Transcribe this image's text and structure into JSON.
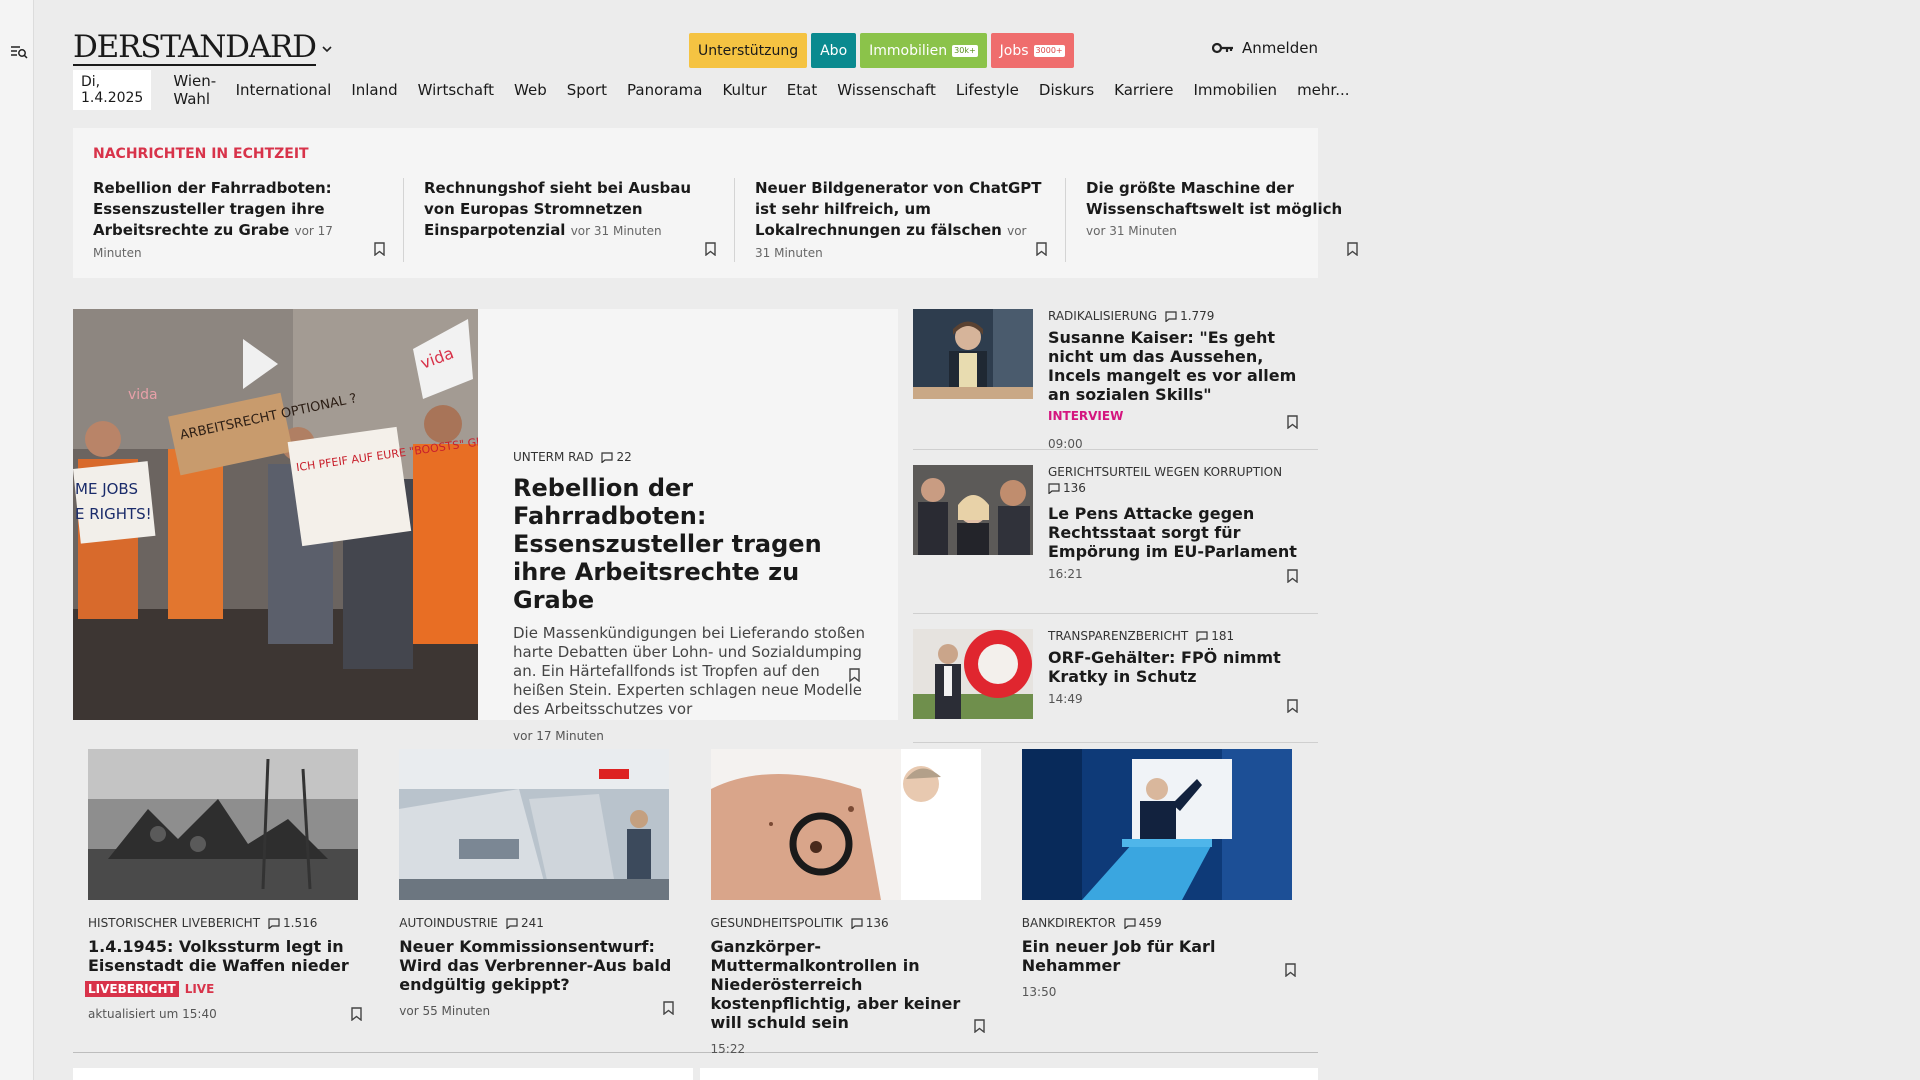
{
  "header": {
    "logo": "DERSTANDARD",
    "pills": [
      {
        "label": "Unterstützung",
        "badge": ""
      },
      {
        "label": "Abo",
        "badge": ""
      },
      {
        "label": "Immobilien",
        "badge": "30k+"
      },
      {
        "label": "Jobs",
        "badge": "3000+"
      }
    ],
    "login_label": "Anmelden"
  },
  "nav": {
    "date": "Di, 1.4.2025",
    "items": [
      "Wien-Wahl",
      "International",
      "Inland",
      "Wirtschaft",
      "Web",
      "Sport",
      "Panorama",
      "Kultur",
      "Etat",
      "Wissenschaft",
      "Lifestyle",
      "Diskurs",
      "Karriere",
      "Immobilien",
      "mehr..."
    ]
  },
  "ticker": {
    "title": "NACHRICHTEN IN ECHTZEIT",
    "items": [
      {
        "headline": "Rebellion der Fahrradboten: Essenszusteller tragen ihre Arbeitsrechte zu Grabe",
        "time": "vor 17 Minuten"
      },
      {
        "headline": "Rechnungshof sieht bei Ausbau von Europas Stromnetzen Einsparpotenzial",
        "time": "vor 31 Minuten"
      },
      {
        "headline": "Neuer Bildgenerator von ChatGPT ist sehr hilfreich, um Lokalrechnungen zu fälschen",
        "time": "vor 31 Minuten"
      },
      {
        "headline": "Die größte Maschine der Wissenschaftswelt ist möglich",
        "time": "vor 31 Minuten"
      }
    ]
  },
  "lead": {
    "kicker": "UNTERM RAD",
    "comments": "22",
    "title": "Rebellion der Fahrradboten: Essenszusteller tragen ihre Arbeitsrechte zu Grabe",
    "teaser": "Die Massenkündigungen bei Lieferando stoßen harte Debatten über Lohn- und Sozialdumping an. Ein Härtefallfonds ist Tropfen auf den heißen Stein. Experten schlagen neue Modelle des Arbeitsschutzes vor",
    "time": "vor 17 Minuten",
    "signs": [
      "ME JOBS",
      "E RIGHTS!",
      "ARBEITSRECHT OPTIONAL ?",
      "ICH PFEIF AUF EURE \"BOOSTS\" GEBT MIR ARBEITSRECHT",
      "vida",
      "vida"
    ]
  },
  "side": [
    {
      "kicker": "RADIKALISIERUNG",
      "comments": "1.779",
      "title": "Susanne Kaiser: \"Es geht nicht um das Aussehen, Incels mangelt es vor allem an sozialen Skills\"",
      "tag": "INTERVIEW",
      "time": "09:00"
    },
    {
      "kicker": "GERICHTSURTEIL WEGEN KORRUPTION",
      "comments": "136",
      "title": "Le Pens Attacke gegen Rechtsstaat sorgt für Empörung im EU-Parlament",
      "tag": "",
      "time": "16:21"
    },
    {
      "kicker": "TRANSPARENZBERICHT",
      "comments": "181",
      "title": "ORF-Gehälter: FPÖ nimmt Kratky in Schutz",
      "tag": "",
      "time": "14:49"
    }
  ],
  "cards": [
    {
      "kicker": "HISTORISCHER LIVEBERICHT",
      "comments": "1.516",
      "title": "1.4.1945: Volkssturm legt in Eisenstadt die Waffen nieder",
      "live_badge": "LIVEBERICHT",
      "live_text": "LIVE",
      "time": "aktualisiert um 15:40"
    },
    {
      "kicker": "AUTOINDUSTRIE",
      "comments": "241",
      "title": "Neuer Kommissionsentwurf: Wird das Verbrenner-Aus bald endgültig gekippt?",
      "live_badge": "",
      "live_text": "",
      "time": "vor 55 Minuten"
    },
    {
      "kicker": "GESUNDHEITSPOLITIK",
      "comments": "136",
      "title": "Ganzkörper-Muttermalkontrollen in Niederösterreich kostenpflichtig, aber keiner will schuld sein",
      "live_badge": "",
      "live_text": "",
      "time": "15:22"
    },
    {
      "kicker": "BANKDIREKTOR",
      "comments": "459",
      "title": "Ein neuer Job für Karl Nehammer",
      "live_badge": "",
      "live_text": "",
      "time": "13:50"
    }
  ],
  "icons": {
    "menu": "menu-search-icon",
    "chevron": "chevron-down-icon",
    "key": "key-icon",
    "comment": "comment-icon",
    "bookmark": "bookmark-icon"
  },
  "colors": {
    "ticker_title": "#d8334a",
    "interview_tag": "#d4157f",
    "live": "#d8334a",
    "pill_support": "#f5c342",
    "pill_abo": "#0a8a8f",
    "pill_immo": "#8bc34a",
    "pill_jobs": "#ef6d6d"
  }
}
